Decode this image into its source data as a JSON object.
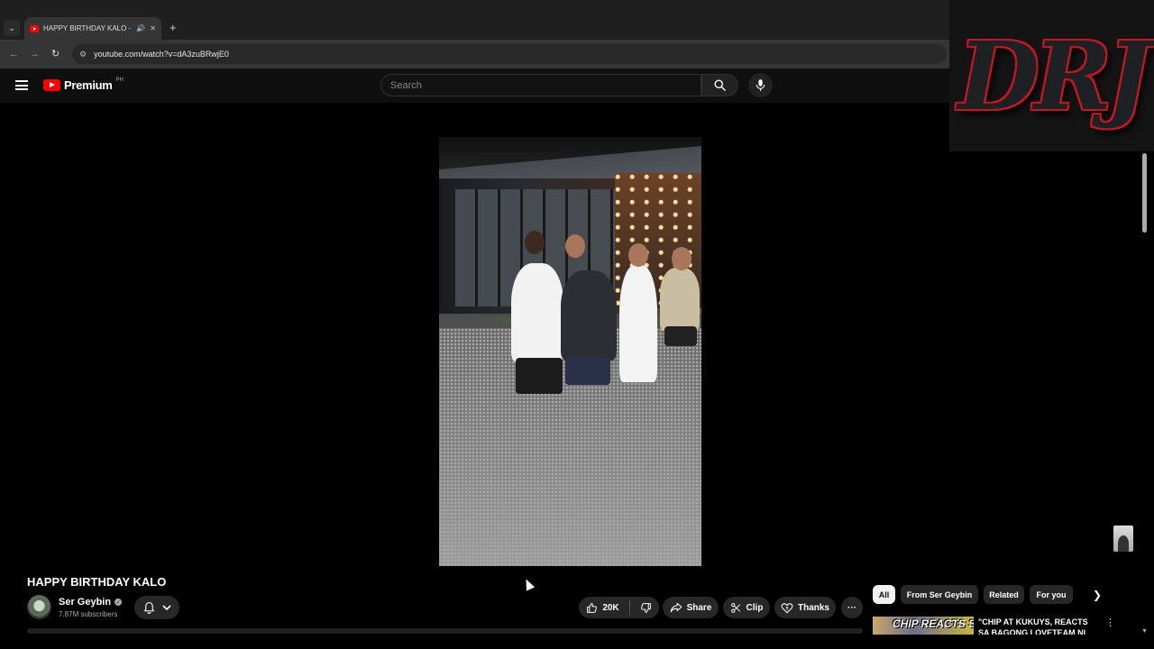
{
  "browser": {
    "tab_title": "HAPPY BIRTHDAY KALO - YouTube",
    "new_tab_symbol": "+",
    "url": "youtube.com/watch?v=dA3zuBRwjE0"
  },
  "header": {
    "brand": "Premium",
    "region": "PH",
    "search_placeholder": "Search"
  },
  "overlay": {
    "watermark": "DRJ",
    "accent_color": "#c01622"
  },
  "video": {
    "title": "HAPPY BIRTHDAY KALO",
    "channel": {
      "name": "Ser Geybin",
      "subscribers": "7.87M subscribers"
    },
    "actions": {
      "likes": "20K",
      "share": "Share",
      "clip": "Clip",
      "thanks": "Thanks",
      "more": "···"
    }
  },
  "sidebar": {
    "chips": [
      {
        "label": "All",
        "active": true
      },
      {
        "label": "From Ser Geybin",
        "active": false
      },
      {
        "label": "Related",
        "active": false
      },
      {
        "label": "For you",
        "active": false
      }
    ],
    "recommendation": {
      "thumb_text": "CHIP REACTS SA",
      "title": "\"CHIP AT KUKUYS, REACTS SA BAGONG LOVETEAM NI"
    }
  },
  "colors": {
    "youtube_red": "#ff0000",
    "background": "#0f0f0f",
    "pill": "#272727"
  }
}
